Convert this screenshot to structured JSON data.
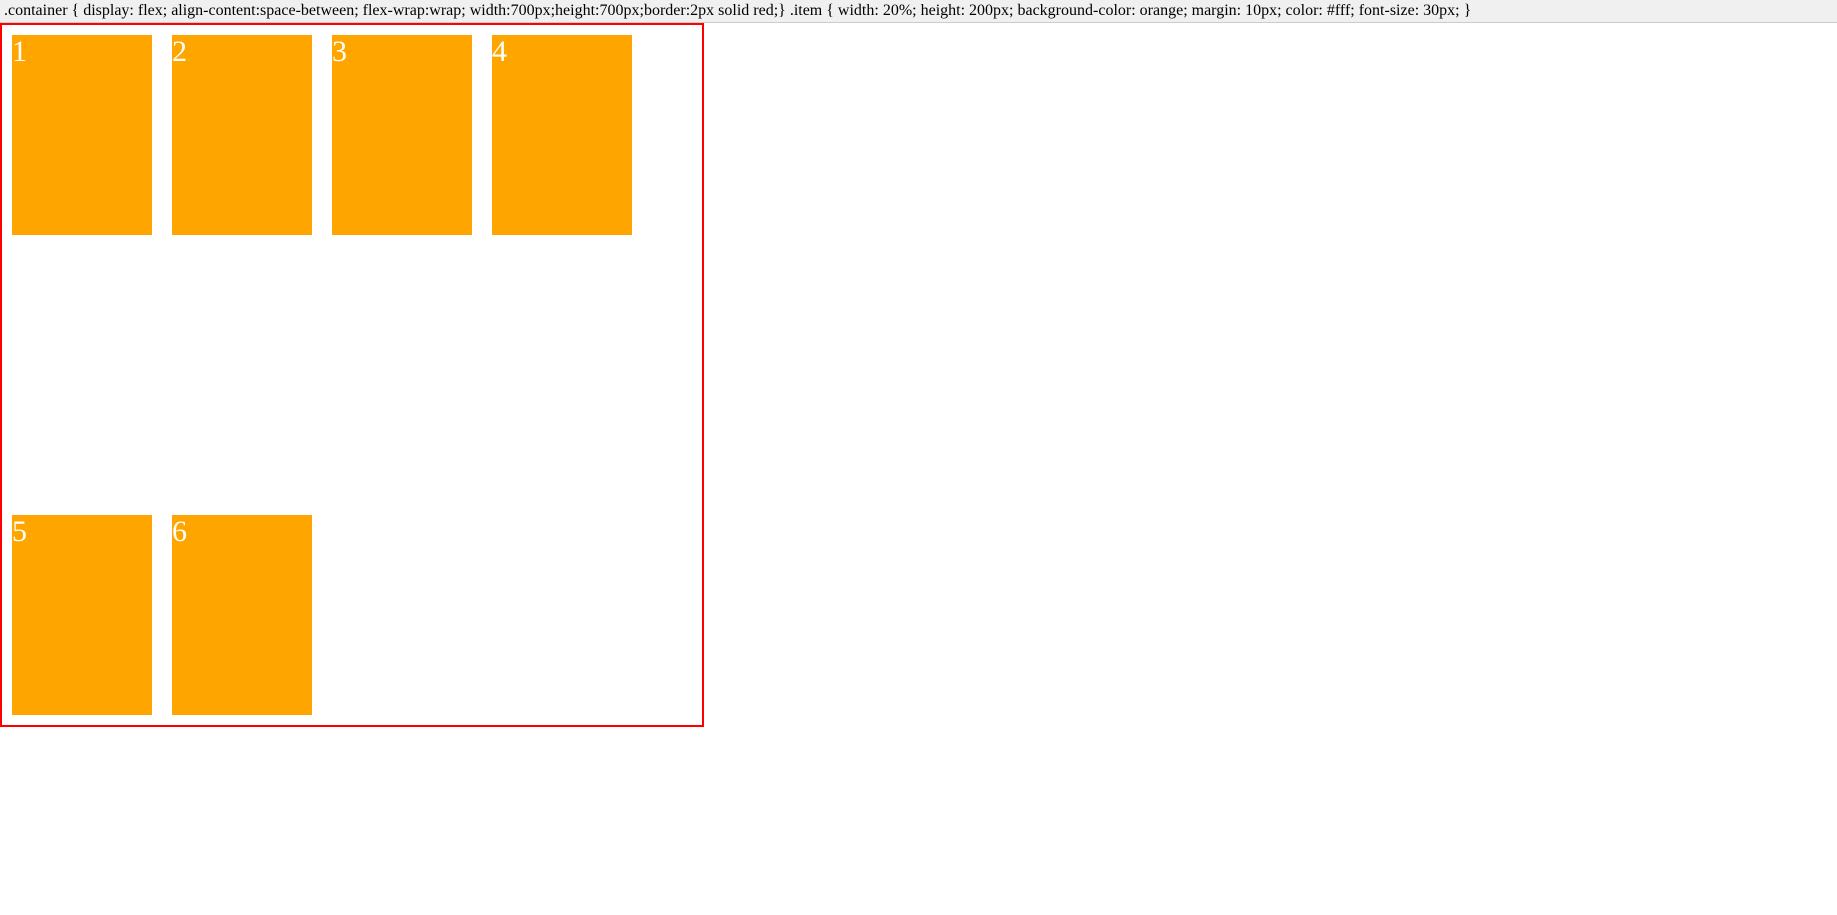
{
  "code_line": ".container { display: flex; align-content:space-between; flex-wrap:wrap; width:700px;height:700px;border:2px solid red;} .item { width: 20%; height: 200px; background-color: orange; margin: 10px; color: #fff; font-size: 30px; }",
  "items": [
    "1",
    "2",
    "3",
    "4",
    "5",
    "6"
  ]
}
